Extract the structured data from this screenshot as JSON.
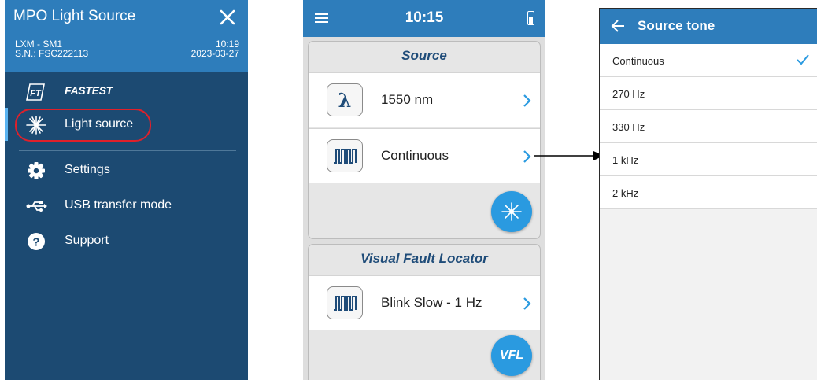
{
  "menu": {
    "title": "MPO Light Source",
    "device": "LXM - SM1",
    "serial": "S.N.: FSC222113",
    "time": "10:19",
    "date": "2023-03-27",
    "items": [
      {
        "label": "FASTEST",
        "icon": "fastest-icon"
      },
      {
        "label": "Light source",
        "icon": "laser-icon",
        "active": true
      },
      {
        "label": "Settings",
        "icon": "gear-icon"
      },
      {
        "label": "USB transfer mode",
        "icon": "usb-icon"
      },
      {
        "label": "Support",
        "icon": "help-icon"
      }
    ],
    "colors": {
      "header": "#2e7dbb",
      "body": "#1c4a72",
      "highlight": "#e0202a"
    }
  },
  "source_screen": {
    "clock": "10:15",
    "source_card": {
      "title": "Source",
      "wavelength_label": "1550 nm",
      "tone_label": "Continuous"
    },
    "vfl_card": {
      "title": "Visual Fault Locator",
      "mode_label": "Blink Slow - 1 Hz",
      "button_label": "VFL"
    }
  },
  "tone_screen": {
    "title": "Source tone",
    "options": [
      {
        "label": "Continuous",
        "selected": true
      },
      {
        "label": "270 Hz",
        "selected": false
      },
      {
        "label": "330 Hz",
        "selected": false
      },
      {
        "label": "1 kHz",
        "selected": false
      },
      {
        "label": "2 kHz",
        "selected": false
      }
    ],
    "colors": {
      "accent": "#2e7dbb",
      "check": "#2a9ae0"
    }
  }
}
